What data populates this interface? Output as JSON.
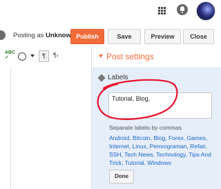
{
  "header": {
    "apps_icon": "apps-grid-icon",
    "notifications_icon": "bell-icon",
    "avatar_icon": "avatar-image"
  },
  "actions": {
    "posting_prefix": "Posting as",
    "posting_user": "Unknown",
    "publish_label": "Publish",
    "save_label": "Save",
    "preview_label": "Preview",
    "close_label": "Close"
  },
  "toolbar": {
    "spell_label": "ABC",
    "ltr_label": "¶",
    "rtl_label": "¶‹"
  },
  "post_settings": {
    "title": "Post settings",
    "labels_heading": "Labels",
    "labels_value": "Tutorial, Blog,",
    "hint": "Separate labels by commas",
    "suggested_labels": "Android, Bitcoin, Blog, Forex, Games, Internet, Linux, Pemrograman, Refair, SSH, Tech News, Technology, Tips And Trick, Tutorial, Windows",
    "done_label": "Done"
  },
  "colors": {
    "accent": "#f26b3a",
    "link": "#1a66c2",
    "panel": "#e6eef9",
    "annotation": "#e8102a"
  }
}
